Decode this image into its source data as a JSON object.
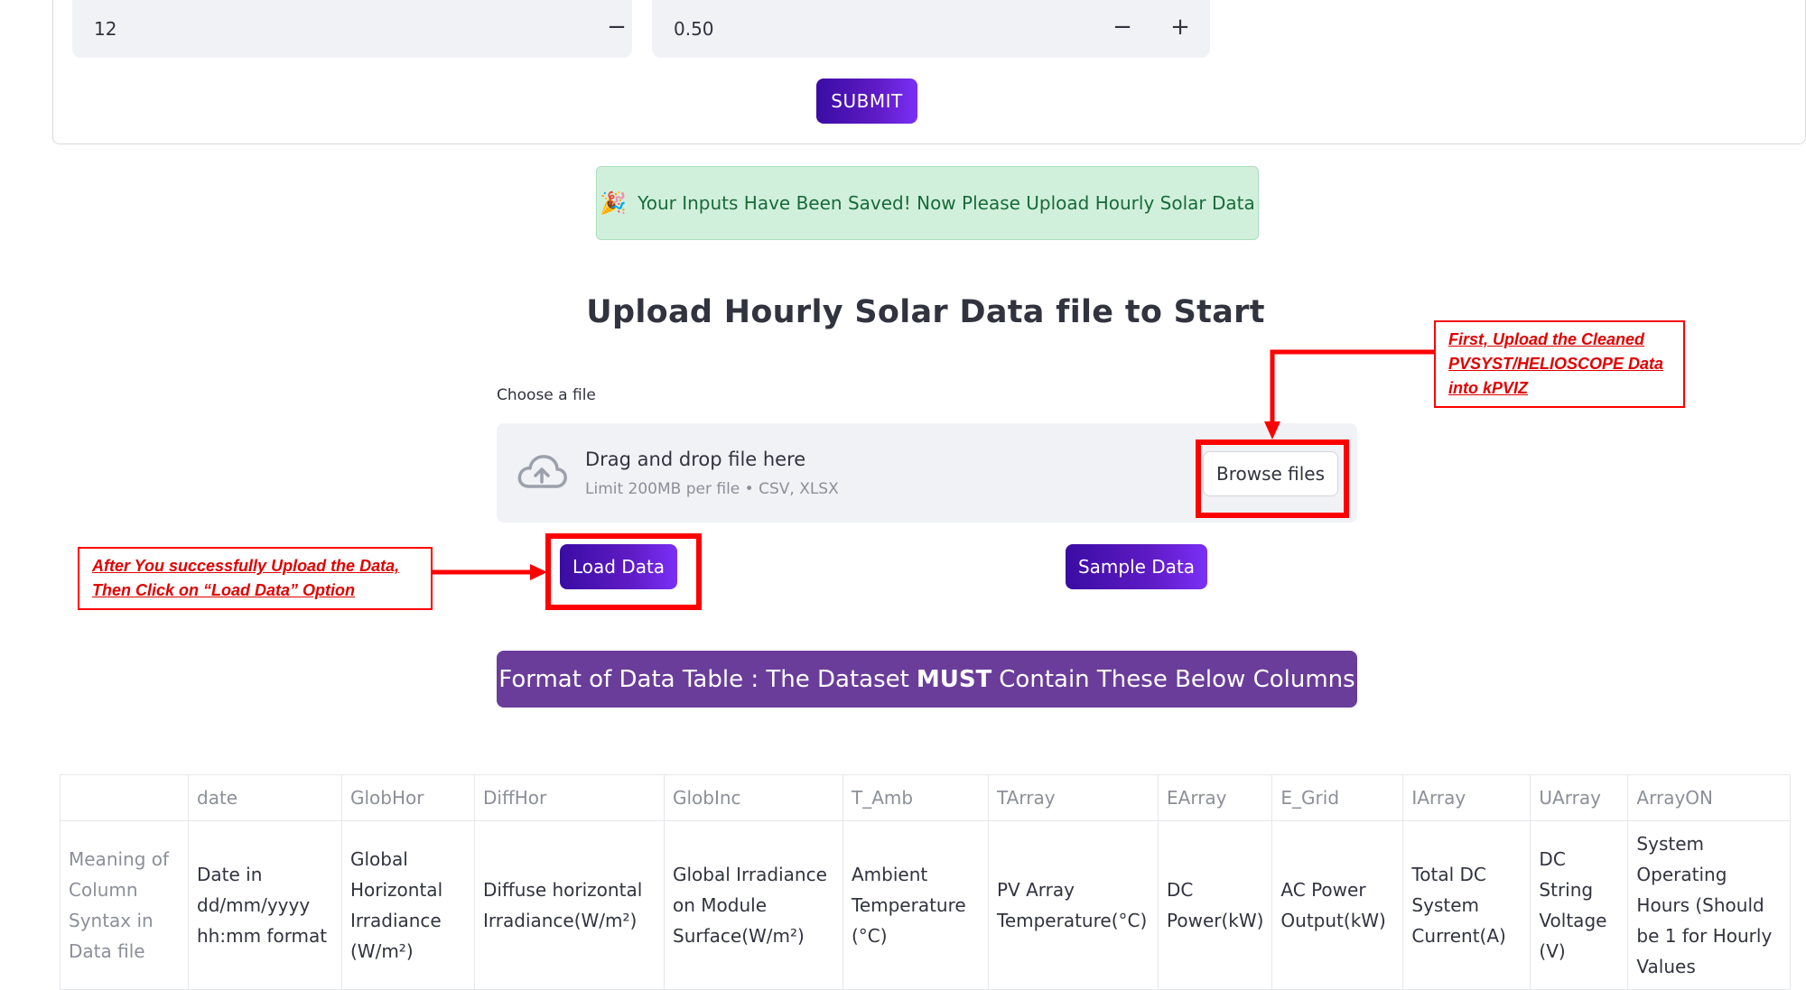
{
  "form": {
    "input_a_value": "12",
    "input_b_value": "0.50",
    "minus_symbol": "−",
    "plus_symbol": "+",
    "submit_label": "SUBMIT"
  },
  "alert": {
    "icon": "party-popper-icon",
    "text": "Your Inputs Have Been Saved! Now Please Upload Hourly Solar Data"
  },
  "upload": {
    "title": "Upload Hourly Solar Data file to Start",
    "file_label": "Choose a file",
    "drop_title": "Drag and drop file here",
    "drop_sub": "Limit 200MB per file • CSV, XLSX",
    "browse_label": "Browse files",
    "cloud_icon": "cloud-upload-icon"
  },
  "actions": {
    "load_label": "Load Data",
    "sample_label": "Sample Data"
  },
  "format_banner": {
    "prefix": "Format of Data Table : The Dataset",
    "emphasis": "MUST",
    "suffix": "Contain These Below Columns"
  },
  "annotations": {
    "browse_note_line1": "First, Upload the Cleaned",
    "browse_note_line2": "PVSYST/HELIOSCOPE Data",
    "browse_note_line3": "into kPVIZ",
    "load_note_line1": "After You successfully Upload the Data,",
    "load_note_line2": "Then Click on “Load Data” Option",
    "color": "#ff0000"
  },
  "columns_table": {
    "headers": [
      "",
      "date",
      "GlobHor",
      "DiffHor",
      "GlobInc",
      "T_Amb",
      "TArray",
      "EArray",
      "E_Grid",
      "IArray",
      "UArray",
      "ArrayON"
    ],
    "row_label": "Meaning of Column Syntax in Data file",
    "meanings": [
      "Date in dd/mm/yyyy hh:mm format",
      "Global Horizontal Irradiance (W/m²)",
      "Diffuse horizontal Irradiance(W/m²)",
      "Global Irradiance on Module Surface(W/m²)",
      "Ambient Temperature (°C)",
      "PV Array Temperature(°C)",
      "DC Power(kW)",
      "AC Power Output(kW)",
      "Total DC System Current(A)",
      "DC String Voltage (V)",
      "System Operating Hours (Should be 1 for Hourly Values"
    ]
  },
  "colors": {
    "accent_purple": "#5f1bc5",
    "banner_purple": "#6a3d9a",
    "success_bg": "#d1f0dc",
    "success_text": "#176b3a"
  }
}
